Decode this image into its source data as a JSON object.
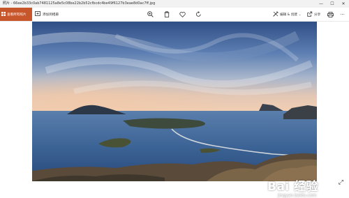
{
  "window": {
    "title": "照片 - 66ee2b33c0ab7481125a8e5c08be22b2b52cfbcdc4be49f6127b3eae8d0ac7ff.jpg",
    "buttons": {
      "minimize": "—",
      "maximize": "☐",
      "close": "✕"
    }
  },
  "toolbar": {
    "view_all_label": "查看所有照片",
    "view_all_icon": "grid-icon",
    "add_label": "添加到相册",
    "add_icon": "add-album-icon",
    "zoom_icon": "zoom-in-icon",
    "delete_icon": "trash-icon",
    "favorite_icon": "heart-icon",
    "rotate_icon": "rotate-icon",
    "edit_label": "编辑 & 创建",
    "edit_icon": "edit-icon",
    "share_label": "分享",
    "share_icon": "share-icon",
    "print_icon": "printer-icon",
    "more_icon": "more-icon"
  },
  "photo": {
    "description_icon": "expand-icon"
  },
  "watermark": {
    "main": "Bai 经验",
    "sub": "jingyan.baidu.com"
  },
  "colors": {
    "accent": "#c7572b"
  }
}
